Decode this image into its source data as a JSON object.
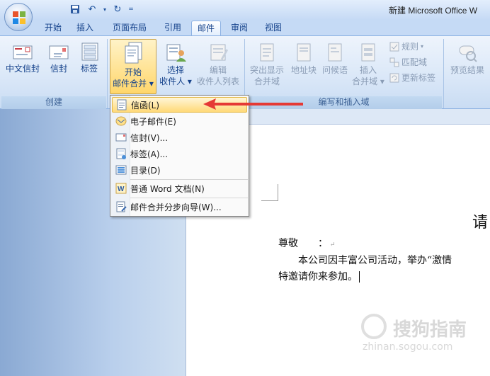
{
  "window": {
    "title": "新建 Microsoft Office W"
  },
  "quick_access": [
    "save",
    "undo",
    "redo",
    "customize"
  ],
  "tabs": [
    "开始",
    "插入",
    "页面布局",
    "引用",
    "邮件",
    "审阅",
    "视图"
  ],
  "active_tab": "邮件",
  "ribbon": {
    "groups": {
      "create": {
        "label": "创建",
        "buttons": [
          "中文信封",
          "信封",
          "标签"
        ]
      },
      "start": {
        "start_merge_line1": "开始",
        "start_merge_line2": "邮件合并",
        "select_line1": "选择",
        "select_line2": "收件人",
        "edit_line1": "编辑",
        "edit_line2": "收件人列表"
      },
      "write_insert": {
        "label": "编写和插入域",
        "highlight_line1": "突出显示",
        "highlight_line2": "合并域",
        "address_block": "地址块",
        "greeting": "问候语",
        "insert_line1": "插入",
        "insert_line2": "合并域",
        "rules": "规则",
        "match_fields": "匹配域",
        "update_labels": "更新标签"
      },
      "preview": {
        "preview_results": "预览结果",
        "abc_badge": "ABC"
      }
    }
  },
  "dropdown_menu": {
    "items": [
      {
        "label": "信函(L)",
        "icon": "letter-icon",
        "selected": true
      },
      {
        "label": "电子邮件(E)",
        "icon": "email-icon",
        "selected": false
      },
      {
        "label": "信封(V)...",
        "icon": "envelope-icon",
        "selected": false
      },
      {
        "label": "标签(A)...",
        "icon": "label-icon",
        "selected": false
      },
      {
        "label": "目录(D)",
        "icon": "directory-icon",
        "selected": false
      },
      {
        "label": "普通 Word 文档(N)",
        "icon": "word-doc-icon",
        "selected": false
      },
      {
        "label": "邮件合并分步向导(W)...",
        "icon": "wizard-icon",
        "selected": false
      }
    ]
  },
  "document": {
    "heading_fragment": "请",
    "salutation": "尊敬",
    "salutation_colon": "：",
    "body_line1": "本公司因丰富公司活动，举办“激情",
    "body_line2": "特邀请你来参加。"
  },
  "watermark": {
    "main": "搜狗指南",
    "sub": "zhinan.sogou.com"
  },
  "colors": {
    "ribbon_text": "#15428b",
    "highlight": "#ffd66b",
    "arrow": "#e53935"
  }
}
